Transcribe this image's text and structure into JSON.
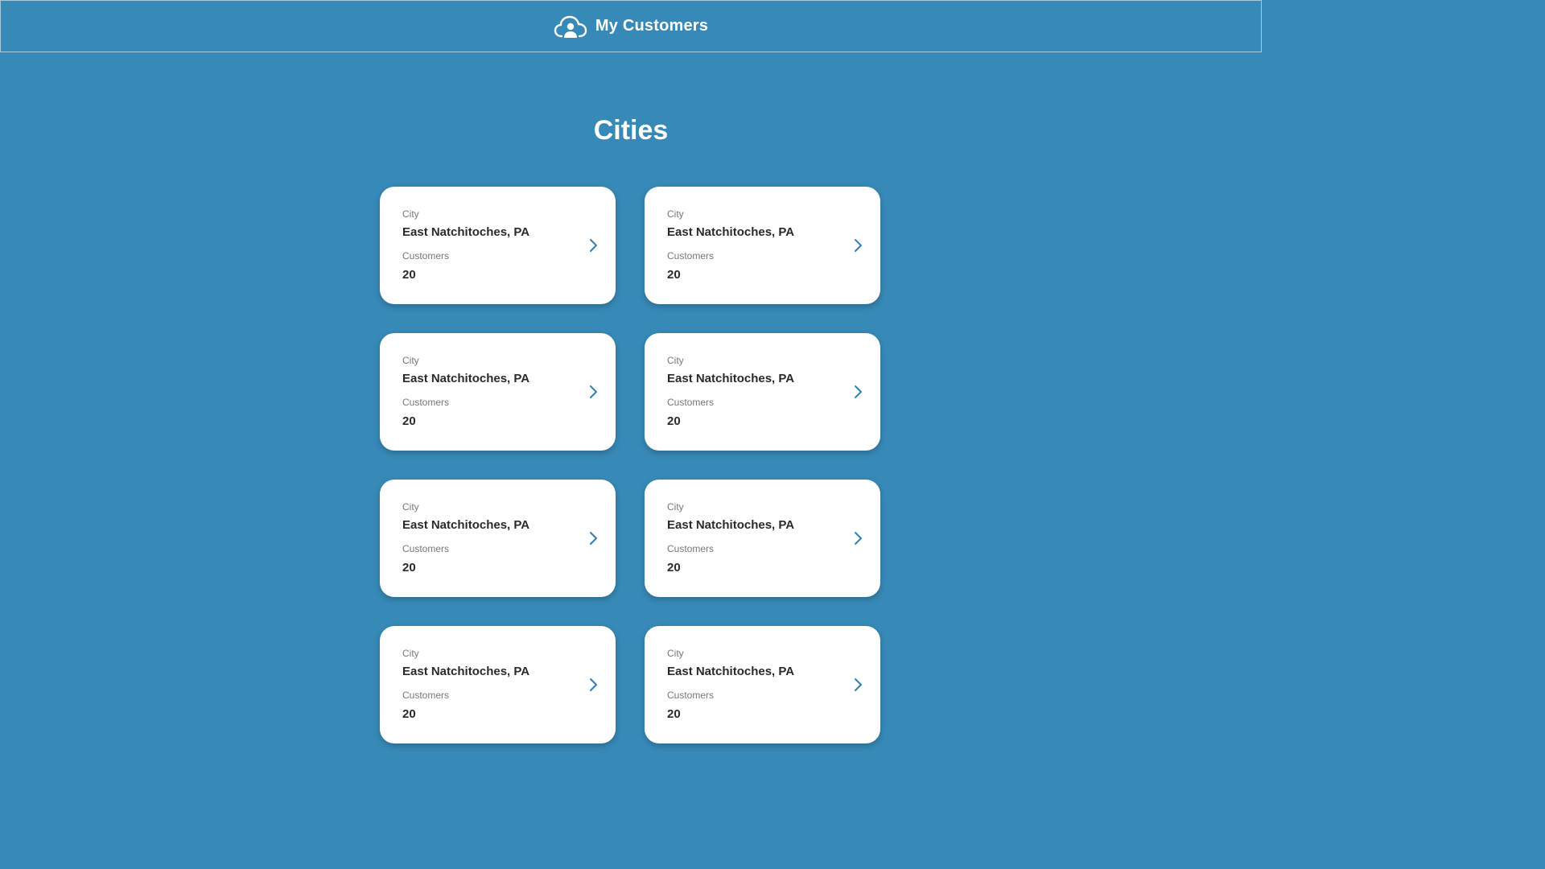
{
  "header": {
    "app_name": "My Customers",
    "icon": "cloud-user-icon"
  },
  "page": {
    "title": "Cities"
  },
  "colors": {
    "background": "#3789b7",
    "card": "#ffffff",
    "accent": "#2f7fb5"
  },
  "cards": [
    {
      "city_label": "City",
      "city": "East Natchitoches, PA",
      "customers_label": "Customers",
      "customers": "20"
    },
    {
      "city_label": "City",
      "city": "East Natchitoches, PA",
      "customers_label": "Customers",
      "customers": "20"
    },
    {
      "city_label": "City",
      "city": "East Natchitoches, PA",
      "customers_label": "Customers",
      "customers": "20"
    },
    {
      "city_label": "City",
      "city": "East Natchitoches, PA",
      "customers_label": "Customers",
      "customers": "20"
    },
    {
      "city_label": "City",
      "city": "East Natchitoches, PA",
      "customers_label": "Customers",
      "customers": "20"
    },
    {
      "city_label": "City",
      "city": "East Natchitoches, PA",
      "customers_label": "Customers",
      "customers": "20"
    },
    {
      "city_label": "City",
      "city": "East Natchitoches, PA",
      "customers_label": "Customers",
      "customers": "20"
    },
    {
      "city_label": "City",
      "city": "East Natchitoches, PA",
      "customers_label": "Customers",
      "customers": "20"
    }
  ]
}
